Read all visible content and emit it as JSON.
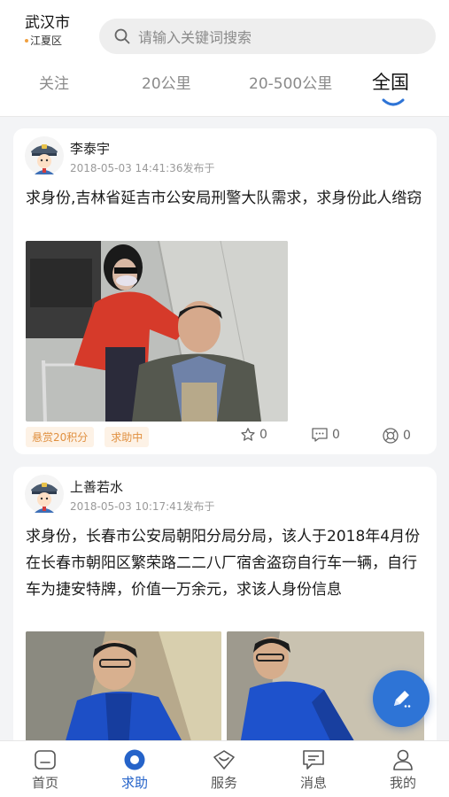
{
  "header": {
    "city": "武汉市",
    "district": "江夏区",
    "search_placeholder": "请输入关键词搜索"
  },
  "tabs": [
    {
      "label": "关注",
      "active": false
    },
    {
      "label": "20公里",
      "active": false
    },
    {
      "label": "20-500公里",
      "active": false
    },
    {
      "label": "全国",
      "active": true
    }
  ],
  "posts": [
    {
      "author": "李泰宇",
      "time": "2018-05-03 14:41:36发布于",
      "text": "求身份,吉林省延吉市公安局刑警大队需求，求身份此人绺窃",
      "reward": "悬赏20积分",
      "status": "求助中",
      "likes": "0",
      "comments": "0",
      "shares": "0"
    },
    {
      "author": "上善若水",
      "time": "2018-05-03 10:17:41发布于",
      "text": "求身份，长春市公安局朝阳分局分局，该人于2018年4月份在长春市朝阳区繁荣路二二八厂宿舍盗窃自行车一辆，自行车为捷安特牌，价值一万余元，求该人身份信息"
    }
  ],
  "nav": [
    {
      "label": "首页",
      "icon": "home-icon"
    },
    {
      "label": "求助",
      "icon": "help-icon",
      "active": true
    },
    {
      "label": "服务",
      "icon": "service-icon"
    },
    {
      "label": "消息",
      "icon": "message-icon"
    },
    {
      "label": "我的",
      "icon": "profile-icon"
    }
  ],
  "colors": {
    "accent": "#2e74d6",
    "active_nav": "#2563c9",
    "badge_text": "#e09040",
    "badge_bg": "#fdf2e6"
  }
}
